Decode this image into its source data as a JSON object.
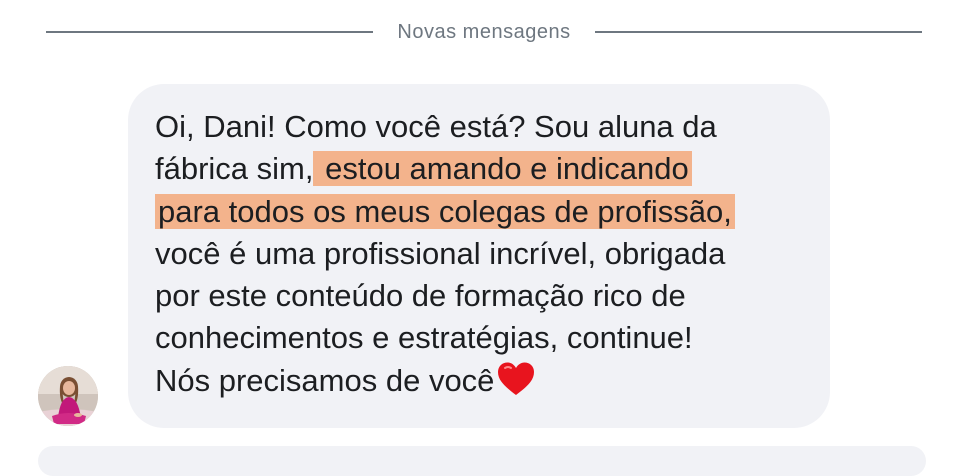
{
  "divider": {
    "label": "Novas mensagens"
  },
  "avatar": {
    "icon": "user-avatar-photo"
  },
  "message": {
    "lines": [
      {
        "text": "Oi, Dani! Como você está? Sou aluna da"
      },
      {
        "text": "fábrica sim,",
        "highlight": " estou amando e indicando"
      },
      {
        "highlight": "para todos os meus colegas de profissão,"
      },
      {
        "text": "você é uma profissional incrível, obrigada"
      },
      {
        "text": "por este conteúdo de formação rico de"
      },
      {
        "text": "conhecimentos e estratégias, continue!"
      },
      {
        "text": "Nós precisamos de você",
        "emoji": "red-heart-icon"
      }
    ],
    "highlight_color": "#f3b38c",
    "bubble_color": "#f1f2f6"
  }
}
